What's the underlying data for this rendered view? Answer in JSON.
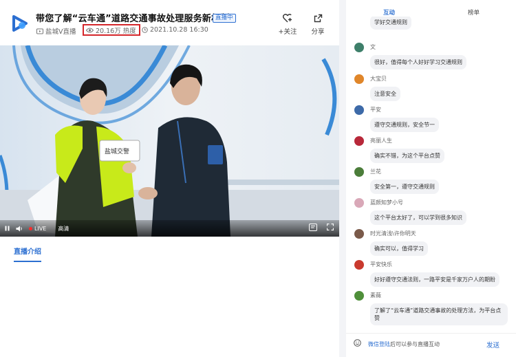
{
  "header": {
    "title": "带您了解“云车通”道路交通事故处理服务新机制",
    "badge": "直播中",
    "source": "盐城V直播",
    "heat": "20.16万 热度",
    "time": "2021.10.28 16:30",
    "follow_label": "+关注",
    "share_label": "分享"
  },
  "video": {
    "live_label": "LIVE",
    "quality_label": "高清",
    "sign_text": "盐城交警"
  },
  "tabs_left": {
    "intro_label": "直播介绍"
  },
  "side": {
    "tabs": {
      "interaction": "互动",
      "ranking": "榜单"
    },
    "messages": [
      {
        "user": "",
        "text": "学好交通规则",
        "avatar_color": "#5a6b55"
      },
      {
        "user": "文",
        "text": "很好，值得每个人好好学习交通规则",
        "avatar_color": "#3e7f6a"
      },
      {
        "user": "大宝贝",
        "text": "注意安全",
        "avatar_color": "#e0862a"
      },
      {
        "user": "平安",
        "text": "遵守交通规则，安全节一",
        "avatar_color": "#3d6aa8"
      },
      {
        "user": "亮丽人生",
        "text": "确实不错，为这个平台点赞",
        "avatar_color": "#b8283a"
      },
      {
        "user": "兰花",
        "text": "安全第一，遵守交通规则",
        "avatar_color": "#4b7d3a"
      },
      {
        "user": "蓝颜知梦小号",
        "text": "这个平台太好了，可以学到很多知识",
        "avatar_color": "#d9a8b8"
      },
      {
        "user": "时光清浅\\许你明天",
        "text": "确实可以，值得学习",
        "avatar_color": "#7a5a4a"
      },
      {
        "user": "平安快乐",
        "text": "好好遵守交通法则，一路平安是千家万户人的期盼",
        "avatar_color": "#c93a2e"
      },
      {
        "user": "素薇",
        "text": "了解了“云车通”道路交通事故的处理方法，为平台点赞",
        "avatar_color": "#4f8f3a"
      }
    ],
    "input": {
      "login_link": "微信登陆",
      "login_tail": "后可以参与直播互动",
      "send_label": "发送"
    }
  },
  "colors": {
    "accent": "#2c6fd1",
    "highlight_box": "#d4262a"
  }
}
